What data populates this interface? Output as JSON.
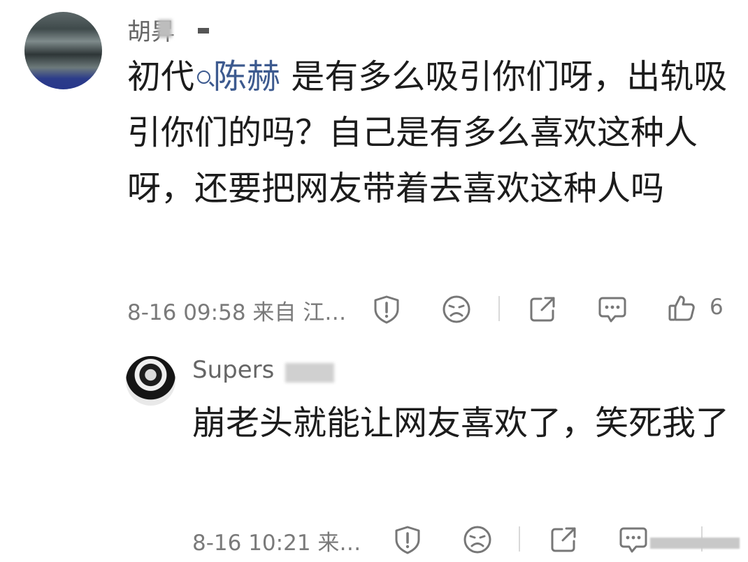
{
  "comment": {
    "username": "胡昇",
    "mention_prefix": "初代",
    "mention": "陈赫",
    "text": " 是有多么吸引你们呀，出轨吸引你们的吗？自己是有多么喜欢这种人呀，还要把网友带着去喜欢这种人吗",
    "time": "8-16 09:58 来自 江…",
    "like_count": "6",
    "icons": [
      "report-icon",
      "dislike-face-icon",
      "share-icon",
      "reply-icon",
      "like-icon"
    ]
  },
  "reply": {
    "username": "Supers",
    "text": "崩老头就能让网友喜欢了，笑死我了",
    "time": "8-16 10:21 来…",
    "icons": [
      "report-icon",
      "dislike-face-icon",
      "share-icon",
      "reply-icon"
    ]
  }
}
